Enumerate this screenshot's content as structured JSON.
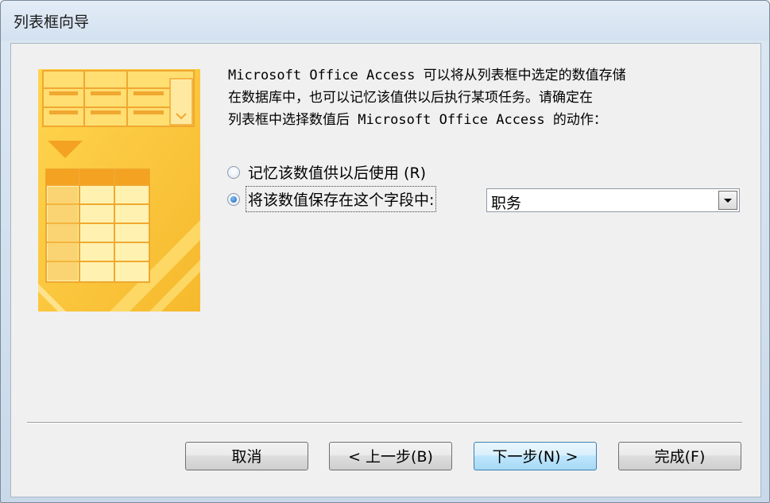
{
  "window": {
    "title": "列表框向导"
  },
  "description": "Microsoft Office Access 可以将从列表框中选定的数值存储\n在数据库中，也可以记忆该值供以后执行某项任务。请确定在\n列表框中选择数值后 Microsoft Office Access 的动作：",
  "options": {
    "remember": {
      "label": "记忆该数值供以后使用 (R)",
      "checked": false
    },
    "store": {
      "label": "将该数值保存在这个字段中:",
      "checked": true
    }
  },
  "field_select": {
    "value": "职务"
  },
  "buttons": {
    "cancel": "取消",
    "back": "< 上一步(B)",
    "next": "下一步(N) >",
    "finish": "完成(F)"
  },
  "icons": {
    "illustration": "list-to-table-illustration",
    "dropdown": "chevron-down-icon"
  },
  "colors": {
    "illustration_yellow": "#ffcc33",
    "illustration_orange": "#f3a321",
    "default_button_border": "#3c7fb1"
  }
}
